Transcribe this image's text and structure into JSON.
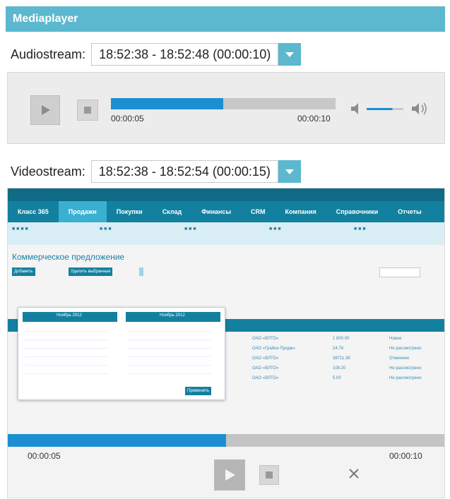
{
  "header": {
    "title": "Mediaplayer"
  },
  "audio": {
    "label": "Audiostream:",
    "selected": "18:52:38 - 18:52:48 (00:00:10)",
    "current_time": "00:00:05",
    "total_time": "00:00:10",
    "progress": 0.5,
    "volume": 0.7
  },
  "video": {
    "label": "Videostream:",
    "selected": "18:52:38 - 18:52:54 (00:00:15)",
    "current_time": "00:00:05",
    "total_time": "00:00:10",
    "progress": 0.5
  },
  "frame": {
    "nav": [
      "Класс 365",
      "Продажи",
      "Покупки",
      "Склад",
      "Финансы",
      "CRM",
      "Компания",
      "Справочники",
      "Отчеты"
    ],
    "active_nav": "Продажи",
    "doc_title": "Коммерческое предложение",
    "toolbar": [
      "Добавить",
      "Удалить выбранные"
    ],
    "calendar_months": [
      "Ноябрь 2012",
      "Ноябрь 2012"
    ],
    "apply_label": "Применить",
    "rows": [
      {
        "contractor": "ОАО «ВЛТО»",
        "sum": "1 800.00",
        "status": "Новое"
      },
      {
        "contractor": "ОАО «Грайон Продж»",
        "sum": "24.78",
        "status": "Не рассмотрено"
      },
      {
        "contractor": "ОАО «ВЛТО»",
        "sum": "38711.38",
        "status": "Отменено"
      },
      {
        "contractor": "ОАО «ВЛТО»",
        "sum": "108.20",
        "status": "Не рассмотрено"
      },
      {
        "contractor": "ОАО «ВЛТО»",
        "sum": "5.00",
        "status": "Не рассмотрено"
      }
    ]
  },
  "colors": {
    "accent": "#5bb8cf",
    "progress": "#1b8fd2",
    "app_nav": "#14809f"
  },
  "icons": {
    "play": "play-icon",
    "stop": "stop-icon",
    "close": "close-icon",
    "volume_low": "volume-low-icon",
    "volume_high": "volume-high-icon",
    "dropdown": "chevron-down-icon"
  }
}
